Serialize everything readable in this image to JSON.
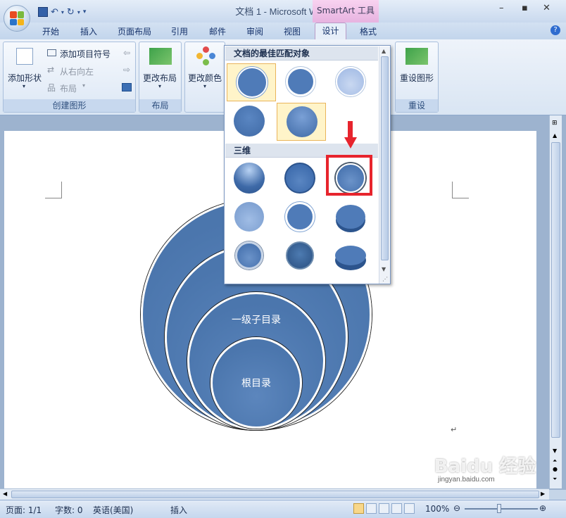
{
  "window": {
    "title": "文档 1 - Microsoft Word",
    "contextual_tab": "SmartArt 工具"
  },
  "tabs": [
    "开始",
    "插入",
    "页面布局",
    "引用",
    "邮件",
    "审阅",
    "视图",
    "设计",
    "格式"
  ],
  "ribbon": {
    "create_group": {
      "add_shape": "添加形状",
      "add_bullet": "添加项目符号",
      "rtl": "从右向左",
      "layout": "布局",
      "label": "创建图形"
    },
    "layout_group": {
      "change_layout": "更改布局",
      "label": "布局"
    },
    "color_group": {
      "change_color": "更改颜色"
    },
    "reset_group": {
      "reset_graphic": "重设图形",
      "label": "重设"
    }
  },
  "gallery": {
    "section_best": "文档的最佳匹配对象",
    "section_3d": "三维"
  },
  "diagram": {
    "level1": "一级子目录",
    "root": "根目录"
  },
  "status": {
    "page": "页面: 1/1",
    "words": "字数: 0",
    "language": "英语(美国)",
    "mode": "插入",
    "zoom": "100%"
  },
  "watermark": "jingyan.baidu.com"
}
